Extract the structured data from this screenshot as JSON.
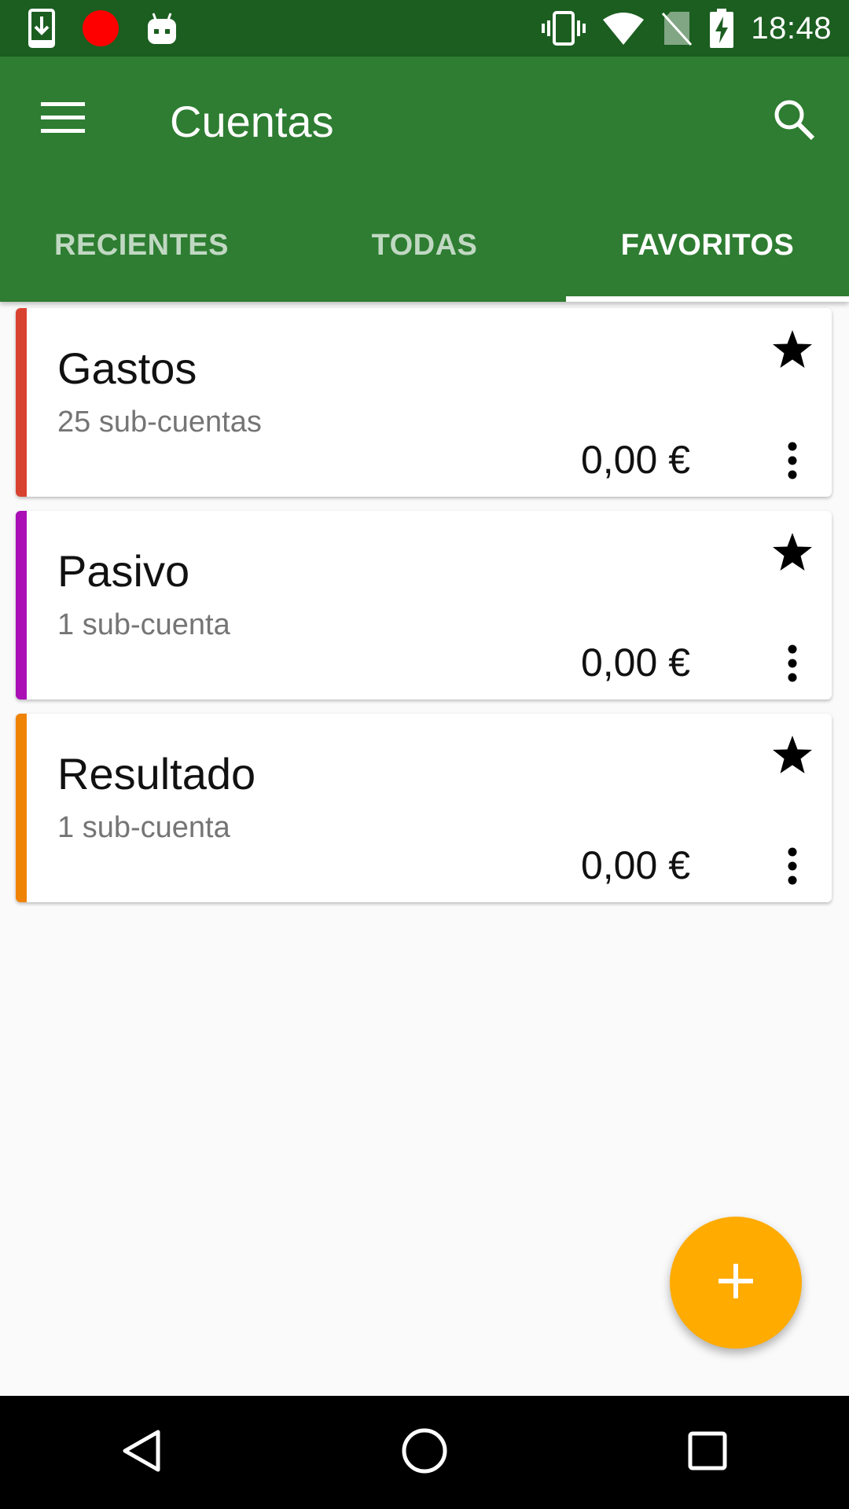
{
  "status_bar": {
    "time": "18:48",
    "icons_left": [
      "download-icon",
      "record-dot-icon",
      "android-icon"
    ],
    "icons_right": [
      "vibrate-icon",
      "wifi-icon",
      "no-sim-icon",
      "battery-charging-icon"
    ]
  },
  "app_bar": {
    "title": "Cuentas",
    "menu_icon": "menu-icon",
    "search_icon": "search-icon",
    "color": "#2e7d32"
  },
  "tabs": [
    {
      "label": "RECIENTES",
      "active": false
    },
    {
      "label": "TODAS",
      "active": false
    },
    {
      "label": "FAVORITOS",
      "active": true
    }
  ],
  "accounts": [
    {
      "name": "Gastos",
      "subaccounts": "25 sub-cuentas",
      "balance": "0,00 €",
      "color": "#d84330",
      "favorite": true
    },
    {
      "name": "Pasivo",
      "subaccounts": "1 sub-cuenta",
      "balance": "0,00 €",
      "color": "#a90fb5",
      "favorite": true
    },
    {
      "name": "Resultado",
      "subaccounts": "1 sub-cuenta",
      "balance": "0,00 €",
      "color": "#ef8305",
      "favorite": true
    }
  ],
  "fab": {
    "icon": "plus-icon",
    "color": "#ffab00"
  },
  "nav_bar": {
    "icons": [
      "back-icon",
      "home-icon",
      "recents-icon"
    ]
  }
}
